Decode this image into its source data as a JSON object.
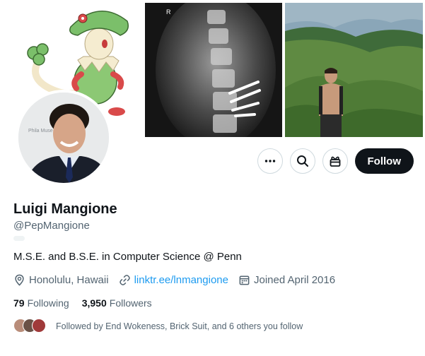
{
  "profile": {
    "name": "Luigi Mangione",
    "handle": "@PepMangione",
    "bio": "M.S.E. and B.S.E. in Computer Science @ Penn",
    "location": "Honolulu, Hawaii",
    "link": "linktr.ee/lnmangione",
    "joined": "Joined April 2016",
    "avatar_caption": "Phila Muse"
  },
  "actions": {
    "follow_label": "Follow"
  },
  "stats": {
    "following_count": "79",
    "following_label": "Following",
    "followers_count": "3,950",
    "followers_label": "Followers"
  },
  "followed_by": {
    "text": "Followed by End Wokeness, Brick Suit, and 6 others you follow"
  },
  "colors": {
    "link": "#1d9bf0",
    "secondary_text": "#536471",
    "follow_button": "#0f1419"
  }
}
